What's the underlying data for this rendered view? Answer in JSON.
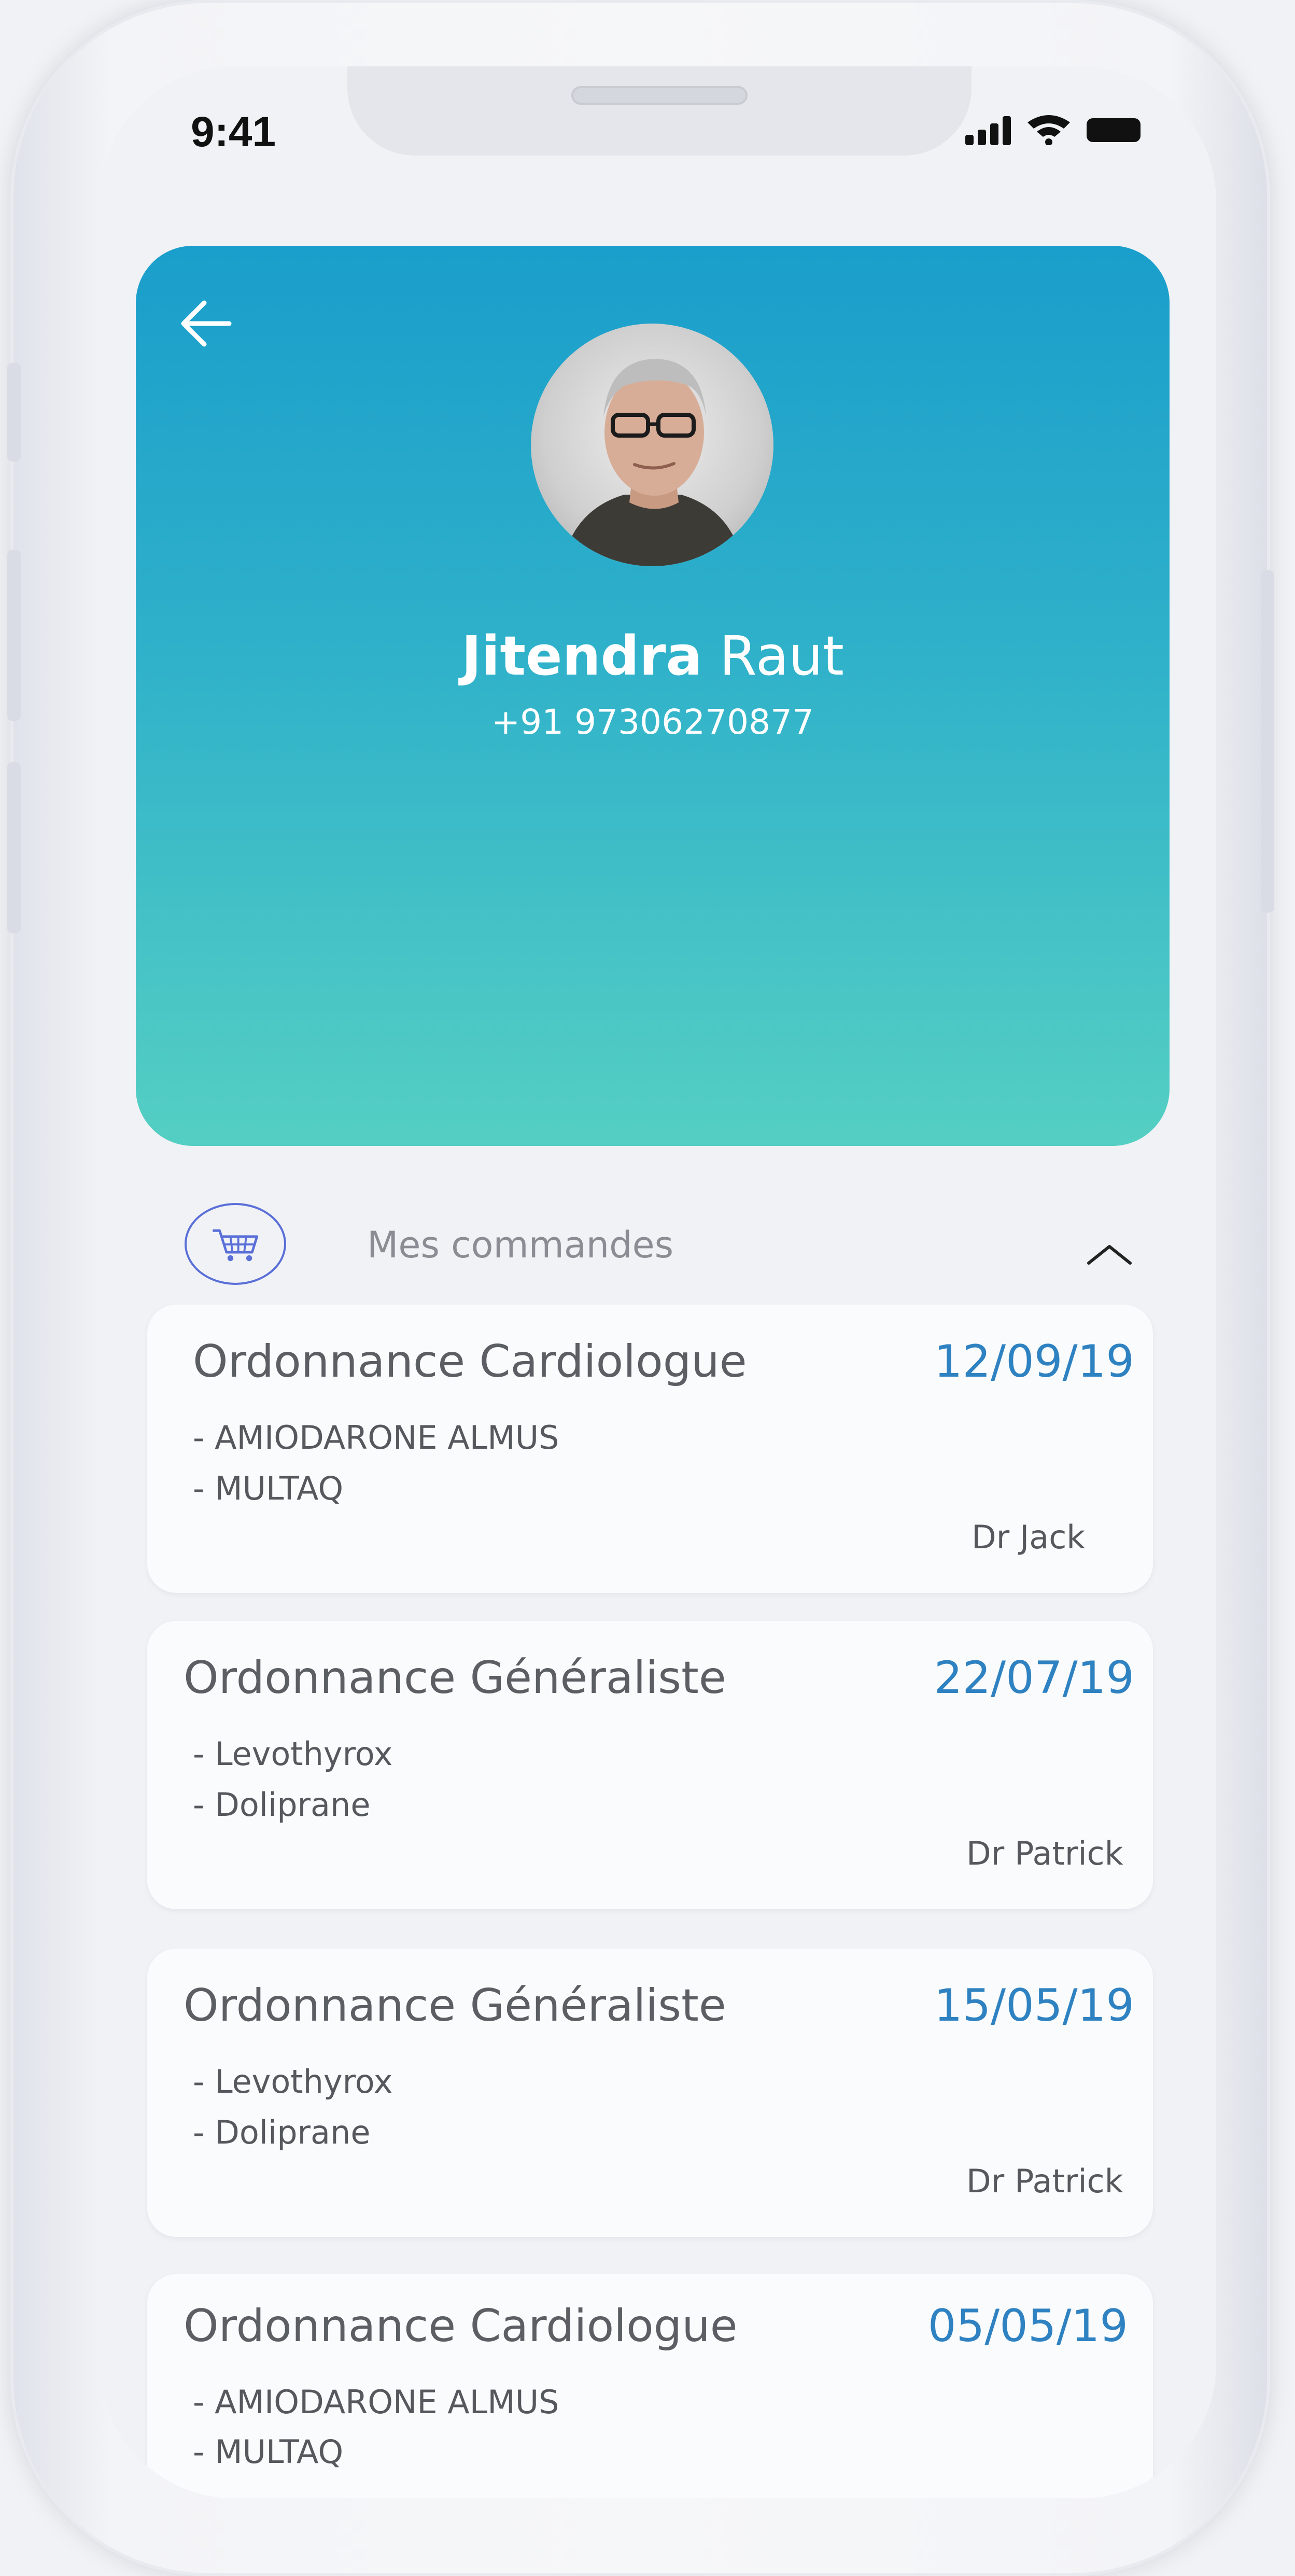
{
  "status_bar": {
    "time": "9:41"
  },
  "profile": {
    "first_name": "Jitendra",
    "last_name": "Raut",
    "phone": "+91 97306270877"
  },
  "section": {
    "title": "Mes commandes"
  },
  "orders": [
    {
      "title": "Ordonnance Cardiologue",
      "date": "12/09/19",
      "items": [
        "- AMIODARONE ALMUS",
        "- MULTAQ"
      ],
      "doctor": "Dr Jack"
    },
    {
      "title": "Ordonnance Généraliste",
      "date": "22/07/19",
      "items": [
        "- Levothyrox",
        "- Doliprane"
      ],
      "doctor": "Dr Patrick"
    },
    {
      "title": "Ordonnance Généraliste",
      "date": "15/05/19",
      "items": [
        "- Levothyrox",
        "- Doliprane"
      ],
      "doctor": "Dr Patrick"
    },
    {
      "title": "Ordonnance Cardiologue",
      "date": "05/05/19",
      "items": [
        "- AMIODARONE ALMUS",
        "- MULTAQ"
      ],
      "doctor": ""
    }
  ],
  "colors": {
    "header_gradient_top": "#1a9ecb",
    "header_gradient_bottom": "#55cfc3",
    "date_blue": "#2f82c1",
    "cart_outline": "#5a6fd8"
  }
}
